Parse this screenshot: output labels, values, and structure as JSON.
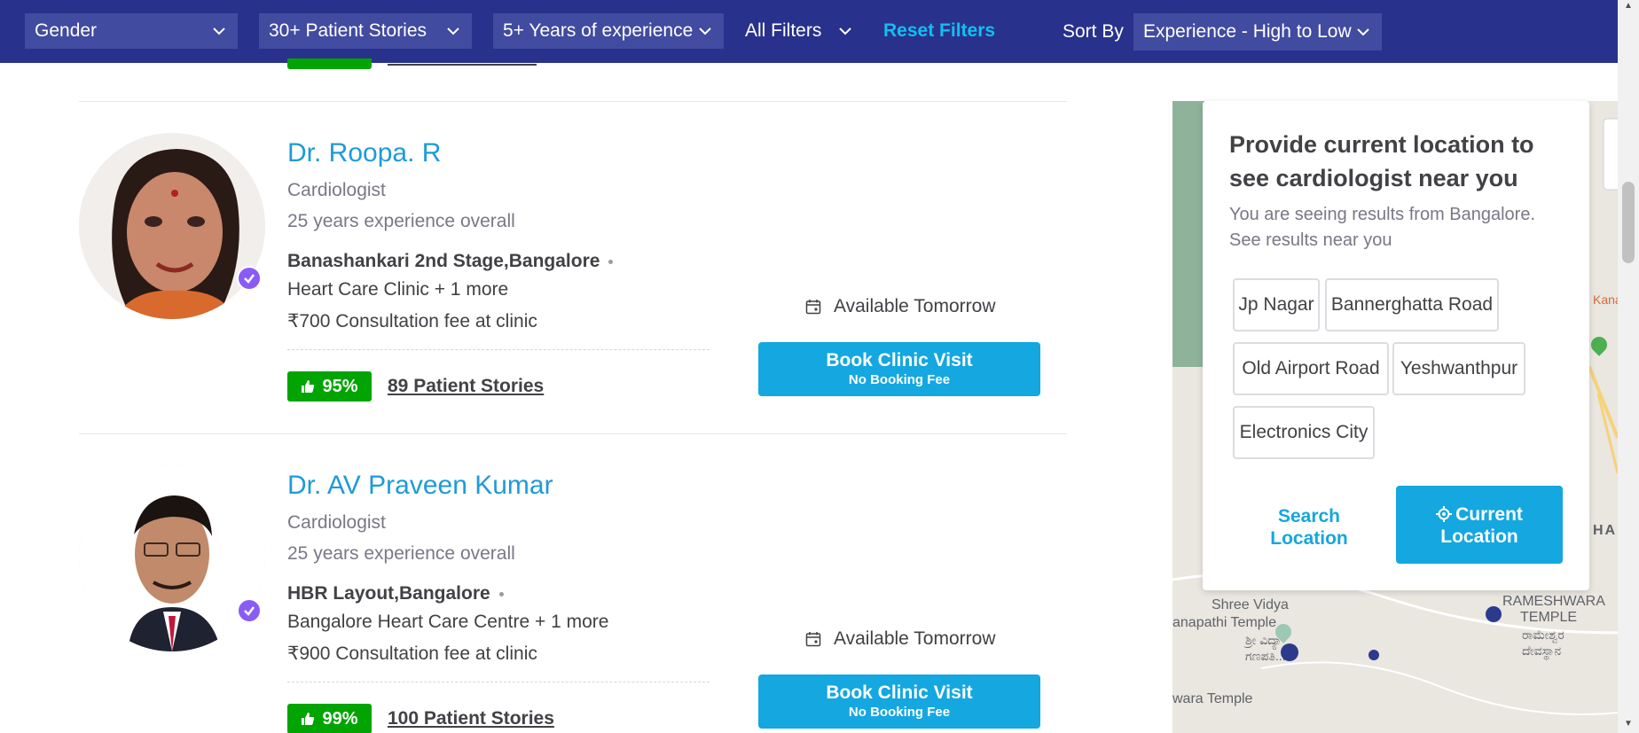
{
  "filters": {
    "gender": "Gender",
    "stories": "30+ Patient Stories",
    "experience": "5+ Years of experience",
    "all": "All Filters",
    "reset": "Reset Filters",
    "sort_label": "Sort By",
    "sort_value": "Experience - High to Low"
  },
  "doctors": [
    {
      "name": "Dr. Roopa. R",
      "specialty": "Cardiologist",
      "experience": "25 years experience overall",
      "location": "Banashankari 2nd Stage,Bangalore",
      "clinic": "Heart Care Clinic + 1 more",
      "fee": "₹700 Consultation fee at clinic",
      "rating": "95%",
      "stories": "89 Patient Stories",
      "availability": "Available Tomorrow",
      "book_label": "Book Clinic Visit",
      "book_sub": "No Booking Fee"
    },
    {
      "name": "Dr. AV Praveen Kumar",
      "specialty": "Cardiologist",
      "experience": "25 years experience overall",
      "location": "HBR Layout,Bangalore",
      "clinic": "Bangalore Heart Care Centre + 1 more",
      "fee": "₹900 Consultation fee at clinic",
      "rating": "99%",
      "stories": "100 Patient Stories",
      "availability": "Available Tomorrow",
      "book_label": "Book Clinic Visit",
      "book_sub": "No Booking Fee"
    }
  ],
  "location_popup": {
    "title": "Provide current location to see cardiologist near you",
    "subtitle": "You are seeing results from Bangalore. See results near you",
    "chips": [
      "Jp Nagar",
      "Bannerghatta Road",
      "Old Airport Road",
      "Yeshwanthpur",
      "Electronics City"
    ],
    "search_label": "Search Location",
    "current_label": "Current Location"
  },
  "map": {
    "labels": {
      "shree_vidya": "Shree Vidya",
      "ganapathi": "anapathi Temple",
      "kannada1": "ಶ್ರೀ ವಿದ್ಯಾ",
      "kannada2": "ಗಣಪತಿ...",
      "rameshwara": "RAMESHWARA",
      "temple": "TEMPLE",
      "kannada3": "ರಾಮೇಶ್ವರ",
      "kannada4": "ದೇವಸ್ಥಾನ",
      "wara_temple": "wara Temple",
      "ha": "HA",
      "kana": "Kana"
    }
  },
  "colors": {
    "topbar": "#28328c",
    "dropdown": "#414ba0",
    "accent": "#14a7e0",
    "link": "#1e9bd7",
    "green": "#01a400"
  }
}
